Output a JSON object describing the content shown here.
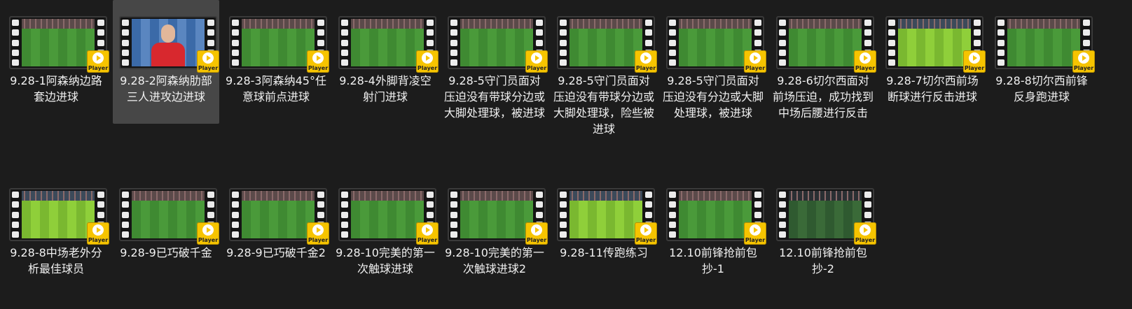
{
  "colors": {
    "background": "#1c1c1c",
    "selected_tile": "#474747",
    "badge": "#f6c400",
    "text": "#f0f0f0"
  },
  "badge_label": "Player",
  "items": [
    {
      "label": "9.28-1阿森纳边路套边进球",
      "selected": false,
      "thumb": "green"
    },
    {
      "label": "9.28-2阿森纳肋部三人进攻边进球",
      "selected": true,
      "thumb": "player"
    },
    {
      "label": "9.28-3阿森纳45°任意球前点进球",
      "selected": false,
      "thumb": "green"
    },
    {
      "label": "9.28-4外脚背凌空射门进球",
      "selected": false,
      "thumb": "green"
    },
    {
      "label": "9.28-5守门员面对压迫没有带球分边或大脚处理球，被进球",
      "selected": false,
      "thumb": "green"
    },
    {
      "label": "9.28-5守门员面对压迫没有带球分边或大脚处理球，险些被进球",
      "selected": false,
      "thumb": "green"
    },
    {
      "label": "9.28-5守门员面对压迫没有分边或大脚处理球，被进球",
      "selected": false,
      "thumb": "green"
    },
    {
      "label": "9.28-6切尔西面对前场压迫，成功找到中场后腰进行反击",
      "selected": false,
      "thumb": "green"
    },
    {
      "label": "9.28-7切尔西前场断球进行反击进球",
      "selected": false,
      "thumb": "bright"
    },
    {
      "label": "9.28-8切尔西前锋反身跑进球",
      "selected": false,
      "thumb": "green"
    },
    {
      "label": "9.28-8中场老外分析最佳球员",
      "selected": false,
      "thumb": "bright"
    },
    {
      "label": "9.28-9已巧破千金",
      "selected": false,
      "thumb": "green"
    },
    {
      "label": "9.28-9已巧破千金2",
      "selected": false,
      "thumb": "green"
    },
    {
      "label": "9.28-10完美的第一次触球进球",
      "selected": false,
      "thumb": "green"
    },
    {
      "label": "9.28-10完美的第一次触球进球2",
      "selected": false,
      "thumb": "green"
    },
    {
      "label": "9.28-11传跑练习",
      "selected": false,
      "thumb": "bright"
    },
    {
      "label": "12.10前锋抢前包抄-1",
      "selected": false,
      "thumb": "green"
    },
    {
      "label": "12.10前锋抢前包抄-2",
      "selected": false,
      "thumb": "dark"
    }
  ]
}
